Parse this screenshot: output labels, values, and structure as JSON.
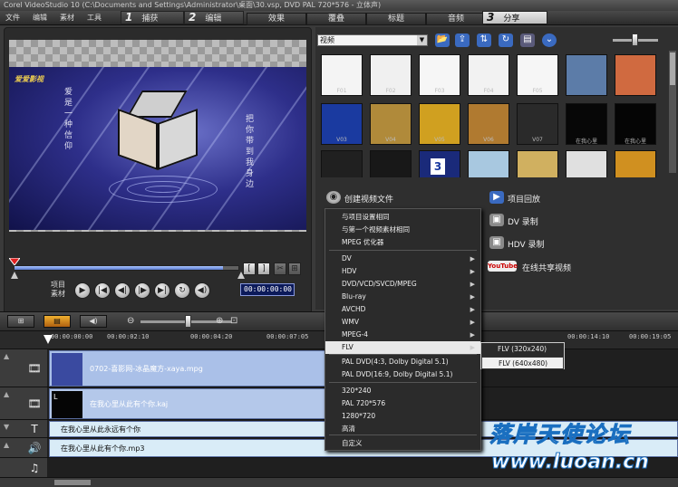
{
  "window": {
    "title": "Corel VideoStudio 10 (C:\\Documents and Settings\\Administrator\\桌面\\30.vsp, DVD PAL 720*576 - 立体声)"
  },
  "menu": [
    "文件",
    "编辑",
    "素材",
    "工具"
  ],
  "steps": [
    {
      "num": "1",
      "label": "捕获"
    },
    {
      "num": "2",
      "label": "编辑"
    },
    {
      "num": "3",
      "label": "分享"
    }
  ],
  "subtabs": [
    "效果",
    "覆叠",
    "标题",
    "音频"
  ],
  "preview": {
    "logo": "爱爱影视",
    "left_text": "爱是一种信仰",
    "right_text": "把你带到我身边",
    "project_label_1": "项目",
    "project_label_2": "素材",
    "timecode": "00:00:00:00",
    "trim_left_label": "[",
    "trim_right_label": "]",
    "controls": {
      "play": "▶",
      "home": "|◀",
      "prev": "◀|",
      "next": "|▶",
      "end": "▶|",
      "repeat": "↻",
      "volume": "◀)",
      "mark_in": "[",
      "mark_out": "]",
      "split": "✂",
      "expand": "⊞"
    }
  },
  "library": {
    "dropdown_value": "视频",
    "dropdown_arrow": "▼",
    "tools": {
      "folder": "📂",
      "import": "⇪",
      "sort": "⇅",
      "refresh": "↻",
      "options": "▤",
      "expand": "⌄"
    },
    "thumbnails": [
      {
        "label": "F01",
        "color": "#f4f4f4"
      },
      {
        "label": "F02",
        "color": "#f0f0f0"
      },
      {
        "label": "F03",
        "color": "#f6f6f6"
      },
      {
        "label": "F04",
        "color": "#f2f2f2"
      },
      {
        "label": "F05",
        "color": "#f6f6f6"
      },
      {
        "label": "",
        "color": "#5c7ca8"
      },
      {
        "label": "",
        "color": "#d06a40"
      },
      {
        "label": "V03",
        "color": "#1a3aa0"
      },
      {
        "label": "V04",
        "color": "#b08a3a"
      },
      {
        "label": "V05",
        "color": "#d0a020"
      },
      {
        "label": "V06",
        "color": "#b07a30"
      },
      {
        "label": "V07",
        "color": "#2a2a2a"
      },
      {
        "label": "在我心里",
        "color": "#070707"
      },
      {
        "label": "在我心里",
        "color": "#050505"
      },
      {
        "label": "",
        "color": "#202020"
      },
      {
        "label": "",
        "color": "#181818"
      },
      {
        "label": "",
        "color": "#1a2a7a"
      },
      {
        "label": "",
        "color": "#a8c8e0"
      },
      {
        "label": "",
        "color": "#d0b060"
      },
      {
        "label": "",
        "color": "#e0e0e0"
      },
      {
        "label": "",
        "color": "#d09020"
      }
    ],
    "thumb_badge_3": "3"
  },
  "share": {
    "create_video": "创建视频文件",
    "project_playback": "项目回放",
    "dv_record": "DV 录制",
    "hdv_record": "HDV 录制",
    "online_share": "在线共享视频",
    "youtube_badge": "YouTube"
  },
  "menu_create": [
    {
      "label": "与项目设置相同",
      "sub": false
    },
    {
      "label": "与第一个视频素材相同",
      "sub": false
    },
    {
      "label": "MPEG 优化器",
      "sub": false
    },
    {
      "label": "DV",
      "sub": true
    },
    {
      "label": "HDV",
      "sub": true
    },
    {
      "label": "DVD/VCD/SVCD/MPEG",
      "sub": true
    },
    {
      "label": "Blu-ray",
      "sub": true
    },
    {
      "label": "AVCHD",
      "sub": true
    },
    {
      "label": "WMV",
      "sub": true
    },
    {
      "label": "MPEG-4",
      "sub": true
    },
    {
      "label": "FLV",
      "sub": true
    },
    {
      "label": "PAL  DVD(4:3, Dolby Digital 5.1)",
      "sub": false
    },
    {
      "label": "PAL  DVD(16:9, Dolby Digital 5.1)",
      "sub": false
    },
    {
      "label": "320*240",
      "sub": false
    },
    {
      "label": "PAL 720*576",
      "sub": false
    },
    {
      "label": "1280*720",
      "sub": false
    },
    {
      "label": "高清",
      "sub": false
    },
    {
      "label": "自定义",
      "sub": false
    }
  ],
  "submenu_arrow": "▶",
  "menu_flv": [
    "FLV (320x240)",
    "FLV (640x480)"
  ],
  "toolbar": {
    "storyboard": "⊞",
    "timeline": "▤",
    "audio": "◀)",
    "zoom_out": "⊖",
    "zoom_in": "⊕",
    "fit": "⊡"
  },
  "timeline": {
    "ticks": [
      "00:00:00:00",
      "00:00:02:10",
      "00:00:04:20",
      "00:00:07:05",
      "00:00:14:10",
      "00:00:19:05"
    ],
    "tracks": [
      {
        "icon": "🎞",
        "clip": "0702-喜影网-冰晶魔方-xaya.mpg",
        "thumb_letter": ""
      },
      {
        "icon": "🎞",
        "clip": "在我心里从此有个你.kaj",
        "thumb_letter": "L"
      },
      {
        "icon": "T",
        "clip": "在我心里从此永远有个你",
        "thumb_letter": ""
      },
      {
        "icon": "🔊",
        "clip": "在我心里从此有个你.mp3",
        "thumb_letter": ""
      },
      {
        "icon": "♫",
        "clip": "",
        "thumb_letter": ""
      }
    ],
    "side_marks": [
      "▲",
      "▲",
      "▼",
      "▲"
    ]
  },
  "watermark": {
    "text": "落岸天使论坛",
    "url": "www.luoan.cn"
  }
}
